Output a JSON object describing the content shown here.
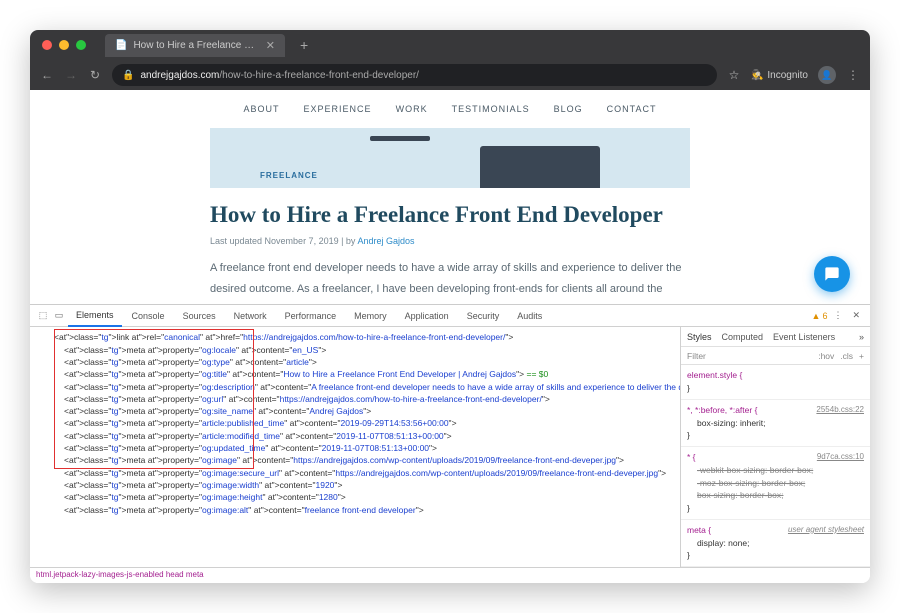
{
  "tab": {
    "title": "How to Hire a Freelance Front"
  },
  "url": {
    "domain": "andrejgajdos.com",
    "path": "/how-to-hire-a-freelance-front-end-developer/"
  },
  "incognito_label": "Incognito",
  "nav": [
    "ABOUT",
    "EXPERIENCE",
    "WORK",
    "TESTIMONIALS",
    "BLOG",
    "CONTACT"
  ],
  "hero_word": "FREELANCE",
  "article": {
    "title": "How to Hire a Freelance Front End Developer",
    "meta_prefix": "Last updated November 7, 2019   |   by ",
    "author": "Andrej Gajdos",
    "body": "A freelance front end developer needs to have a wide array of skills and experience to deliver the desired outcome. As a freelancer, I have been developing front-ends for clients all around the world in many different industries. A lot of people asked me:"
  },
  "devtools": {
    "tabs": [
      "Elements",
      "Console",
      "Sources",
      "Network",
      "Performance",
      "Memory",
      "Application",
      "Security",
      "Audits"
    ],
    "warn_count": "6",
    "side_tabs": [
      "Styles",
      "Computed",
      "Event Listeners"
    ],
    "filter_placeholder": "Filter",
    "hov": ":hov",
    "cls": ".cls",
    "crumb": "html.jetpack-lazy-images-js-enabled   head   meta",
    "code": [
      {
        "ind": 1,
        "raw": "<link rel=\"canonical\" href=\"https://andrejgajdos.com/how-to-hire-a-freelance-front-end-developer/\">"
      },
      {
        "ind": 2,
        "raw": "<meta property=\"og:locale\" content=\"en_US\">"
      },
      {
        "ind": 2,
        "raw": "<meta property=\"og:type\" content=\"article\">"
      },
      {
        "ind": 2,
        "raw": "<meta property=\"og:title\" content=\"How to Hire a Freelance Front End Developer | Andrej Gajdos\"> == $0"
      },
      {
        "ind": 2,
        "raw": "<meta property=\"og:description\" content=\"A freelance front-end developer needs to have a wide array of skills and experience to deliver the desired outcome. As a freelancer, I have been developing…\">"
      },
      {
        "ind": 2,
        "raw": "<meta property=\"og:url\" content=\"https://andrejgajdos.com/how-to-hire-a-freelance-front-end-developer/\">"
      },
      {
        "ind": 2,
        "raw": "<meta property=\"og:site_name\" content=\"Andrej Gajdos\">"
      },
      {
        "ind": 2,
        "raw": "<meta property=\"article:published_time\" content=\"2019-09-29T14:53:56+00:00\">"
      },
      {
        "ind": 2,
        "raw": "<meta property=\"article:modified_time\" content=\"2019-11-07T08:51:13+00:00\">"
      },
      {
        "ind": 2,
        "raw": "<meta property=\"og:updated_time\" content=\"2019-11-07T08:51:13+00:00\">"
      },
      {
        "ind": 2,
        "raw": "<meta property=\"og:image\" content=\"https://andrejgajdos.com/wp-content/uploads/2019/09/freelance-front-end-deveper.jpg\">"
      },
      {
        "ind": 2,
        "raw": "<meta property=\"og:image:secure_url\" content=\"https://andrejgajdos.com/wp-content/uploads/2019/09/freelance-front-end-deveper.jpg\">"
      },
      {
        "ind": 2,
        "raw": "<meta property=\"og:image:width\" content=\"1920\">"
      },
      {
        "ind": 2,
        "raw": "<meta property=\"og:image:height\" content=\"1280\">"
      },
      {
        "ind": 2,
        "raw": "<meta property=\"og:image:alt\" content=\"freelance front-end developer\">"
      }
    ],
    "styles": {
      "r1": {
        "sel": "element.style {",
        "body": "}",
        "src": ""
      },
      "r2": {
        "sel": "*, *:before, *:after {",
        "body": "box-sizing: inherit;",
        "close": "}",
        "src": "2554b.css:22"
      },
      "r3": {
        "sel": "* {",
        "l1": "-webkit-box-sizing: border-box;",
        "l2": "-moz-box-sizing: border-box;",
        "l3": "box-sizing: border-box;",
        "close": "}",
        "src": "9d7ca.css:10"
      },
      "r4": {
        "sel": "meta {",
        "body": "display: none;",
        "close": "}",
        "src": "user agent stylesheet"
      }
    }
  }
}
